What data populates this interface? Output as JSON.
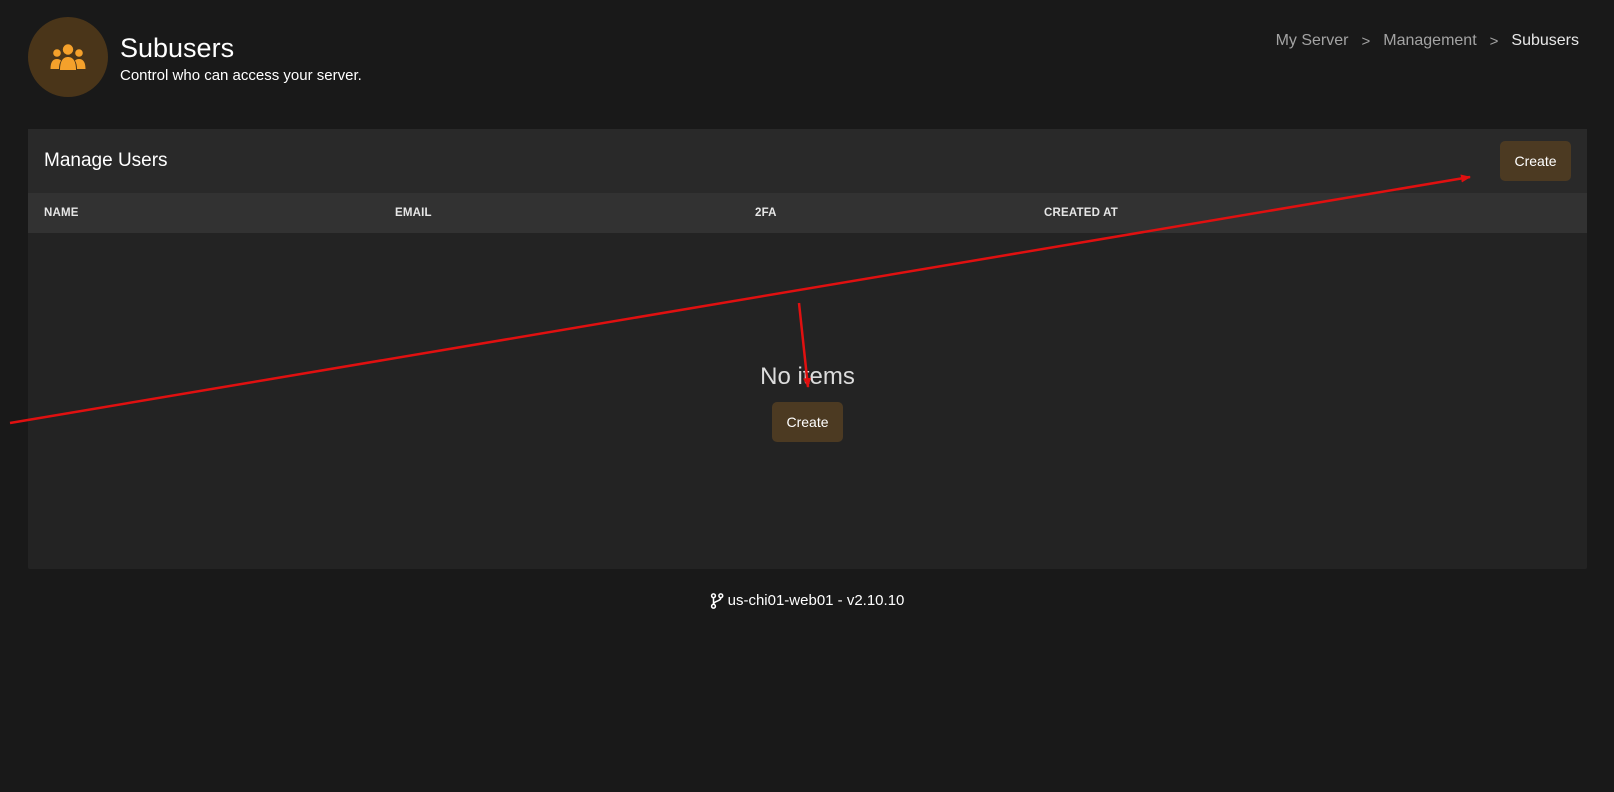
{
  "header": {
    "title": "Subusers",
    "subtitle": "Control who can access your server.",
    "icon": "users-icon",
    "accent_color": "#f5a12b"
  },
  "breadcrumb": {
    "items": [
      "My Server",
      "Management",
      "Subusers"
    ],
    "separator": ">"
  },
  "card": {
    "title": "Manage Users",
    "create_label": "Create",
    "columns": [
      "NAME",
      "EMAIL",
      "2FA",
      "CREATED AT"
    ],
    "empty_title": "No items",
    "empty_create_label": "Create"
  },
  "footer": {
    "icon": "git-branch-icon",
    "text": "us-chi01-web01 - v2.10.10"
  },
  "colors": {
    "background": "#191919",
    "card": "#232323",
    "button": "#4c3a22",
    "annotation_arrow": "#e01010"
  }
}
